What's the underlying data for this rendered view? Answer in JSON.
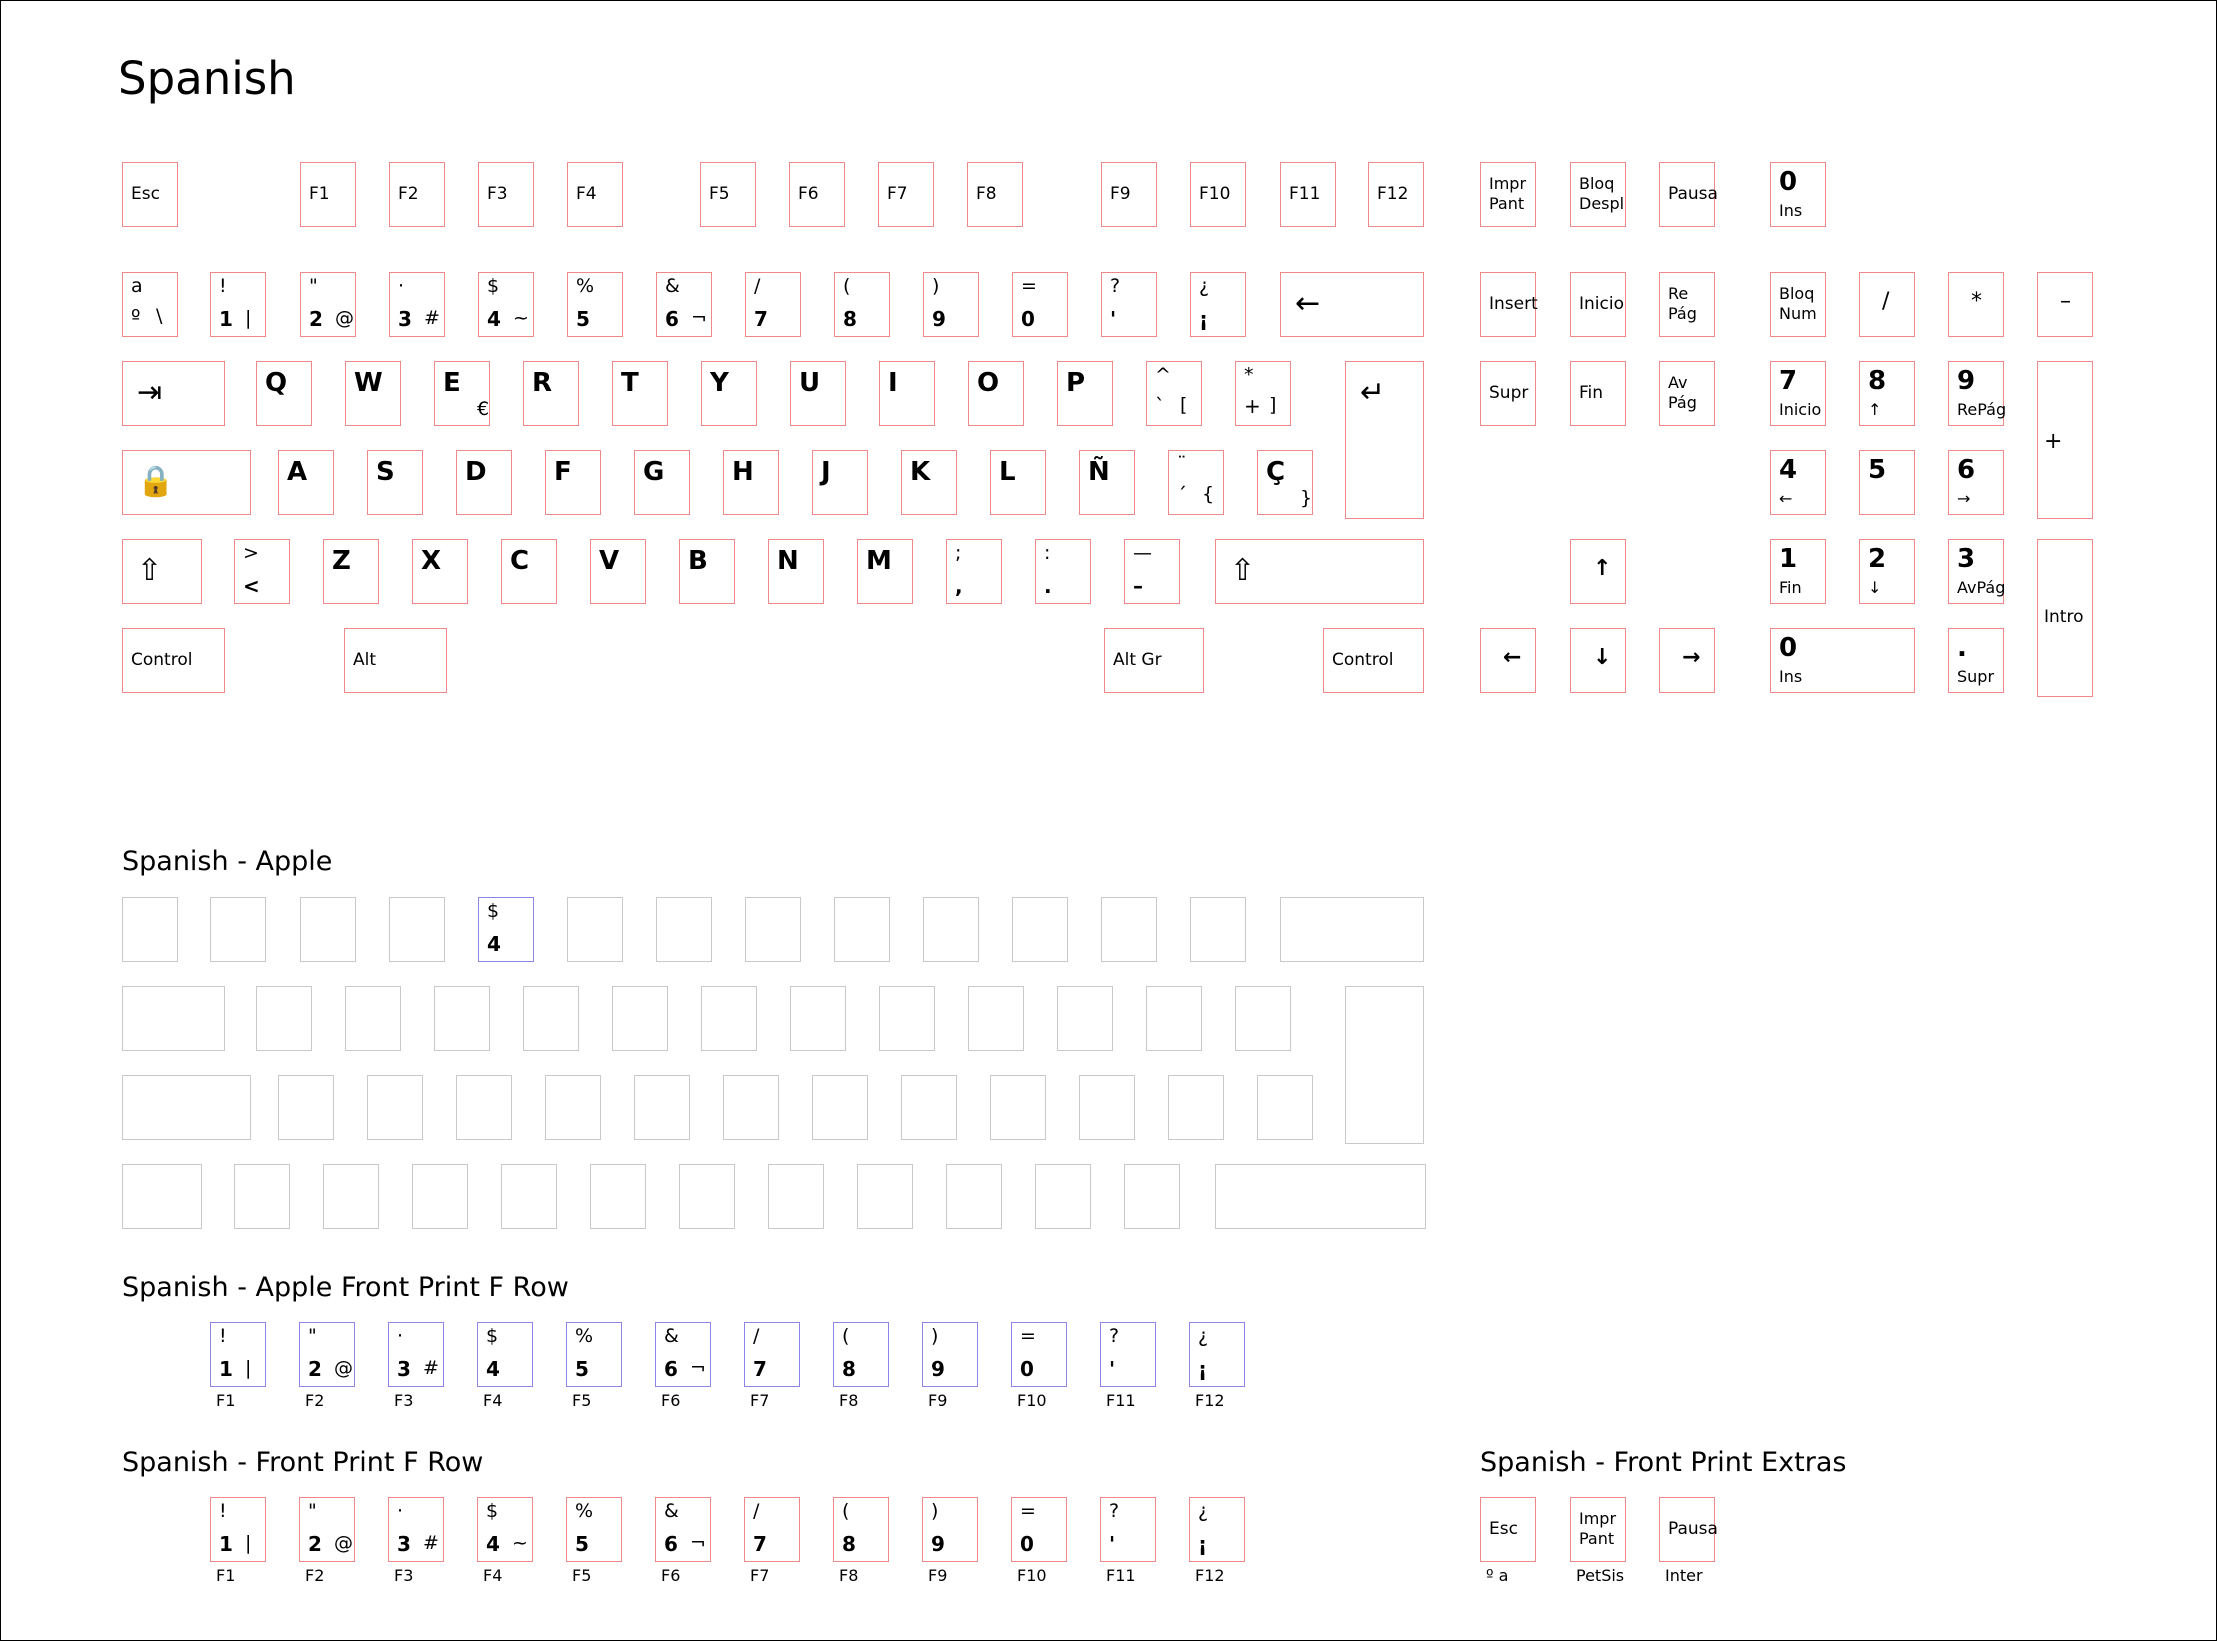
{
  "titles": {
    "main": "Spanish",
    "apple": "Spanish - Apple",
    "apple_front_f": "Spanish - Apple Front Print F Row",
    "front_f": "Spanish - Front Print F Row",
    "front_extras": "Spanish - Front Print Extras"
  },
  "colors": {
    "key_border": "#f08a8a",
    "blank_key_border": "#c9c9c9",
    "highlight_key_border": "#8c84e8"
  },
  "main": {
    "fn_row": [
      {
        "name": "key-esc",
        "labels": [
          "Esc"
        ]
      },
      {
        "name": "key-f1",
        "labels": [
          "F1"
        ]
      },
      {
        "name": "key-f2",
        "labels": [
          "F2"
        ]
      },
      {
        "name": "key-f3",
        "labels": [
          "F3"
        ]
      },
      {
        "name": "key-f4",
        "labels": [
          "F4"
        ]
      },
      {
        "name": "key-f5",
        "labels": [
          "F5"
        ]
      },
      {
        "name": "key-f6",
        "labels": [
          "F6"
        ]
      },
      {
        "name": "key-f7",
        "labels": [
          "F7"
        ]
      },
      {
        "name": "key-f8",
        "labels": [
          "F8"
        ]
      },
      {
        "name": "key-f9",
        "labels": [
          "F9"
        ]
      },
      {
        "name": "key-f10",
        "labels": [
          "F10"
        ]
      },
      {
        "name": "key-f11",
        "labels": [
          "F11"
        ]
      },
      {
        "name": "key-f12",
        "labels": [
          "F12"
        ]
      },
      {
        "name": "key-impr-pant",
        "labels": [
          "Impr",
          "Pant"
        ]
      },
      {
        "name": "key-bloq-despl",
        "labels": [
          "Bloq",
          "Despl"
        ]
      },
      {
        "name": "key-pausa",
        "labels": [
          "Pausa"
        ]
      },
      {
        "name": "key-extra-0-ins",
        "labels": [
          "0",
          "Ins"
        ]
      }
    ],
    "number_row": [
      {
        "name": "key-ordinal",
        "labels": [
          "a",
          "º",
          "\\"
        ]
      },
      {
        "name": "key-1",
        "labels": [
          "!",
          "1",
          "|"
        ]
      },
      {
        "name": "key-2",
        "labels": [
          "\"",
          "2",
          "@"
        ]
      },
      {
        "name": "key-3",
        "labels": [
          "·",
          "3",
          "#"
        ]
      },
      {
        "name": "key-4",
        "labels": [
          "$",
          "4",
          "~"
        ]
      },
      {
        "name": "key-5",
        "labels": [
          "%",
          "5"
        ]
      },
      {
        "name": "key-6",
        "labels": [
          "&",
          "6",
          "¬"
        ]
      },
      {
        "name": "key-7",
        "labels": [
          "/",
          "7"
        ]
      },
      {
        "name": "key-8",
        "labels": [
          "(",
          "8"
        ]
      },
      {
        "name": "key-9",
        "labels": [
          ")",
          "9"
        ]
      },
      {
        "name": "key-0",
        "labels": [
          "=",
          "0"
        ]
      },
      {
        "name": "key-apostrophe",
        "labels": [
          "?",
          "'"
        ]
      },
      {
        "name": "key-inverted-exclamation",
        "labels": [
          "¿",
          "¡"
        ]
      },
      {
        "name": "key-backspace",
        "labels": [
          "←"
        ]
      }
    ],
    "top_row": [
      {
        "name": "key-tab",
        "labels": [
          "⇥"
        ]
      },
      {
        "name": "key-q",
        "labels": [
          "Q"
        ]
      },
      {
        "name": "key-w",
        "labels": [
          "W"
        ]
      },
      {
        "name": "key-e",
        "labels": [
          "E",
          "€"
        ]
      },
      {
        "name": "key-r",
        "labels": [
          "R"
        ]
      },
      {
        "name": "key-t",
        "labels": [
          "T"
        ]
      },
      {
        "name": "key-y",
        "labels": [
          "Y"
        ]
      },
      {
        "name": "key-u",
        "labels": [
          "U"
        ]
      },
      {
        "name": "key-i",
        "labels": [
          "I"
        ]
      },
      {
        "name": "key-o",
        "labels": [
          "O"
        ]
      },
      {
        "name": "key-p",
        "labels": [
          "P"
        ]
      },
      {
        "name": "key-grave",
        "labels": [
          "^",
          "`",
          "["
        ]
      },
      {
        "name": "key-plus",
        "labels": [
          "*",
          "+",
          "]"
        ]
      },
      {
        "name": "key-enter",
        "labels": [
          "↵"
        ]
      }
    ],
    "home_row": [
      {
        "name": "key-caps-lock",
        "labels": [
          "🔒"
        ]
      },
      {
        "name": "key-a",
        "labels": [
          "A"
        ]
      },
      {
        "name": "key-s",
        "labels": [
          "S"
        ]
      },
      {
        "name": "key-d",
        "labels": [
          "D"
        ]
      },
      {
        "name": "key-f",
        "labels": [
          "F"
        ]
      },
      {
        "name": "key-g",
        "labels": [
          "G"
        ]
      },
      {
        "name": "key-h",
        "labels": [
          "H"
        ]
      },
      {
        "name": "key-j",
        "labels": [
          "J"
        ]
      },
      {
        "name": "key-k",
        "labels": [
          "K"
        ]
      },
      {
        "name": "key-l",
        "labels": [
          "L"
        ]
      },
      {
        "name": "key-n-tilde",
        "labels": [
          "Ñ"
        ]
      },
      {
        "name": "key-acute",
        "labels": [
          "¨",
          "´",
          "{"
        ]
      },
      {
        "name": "key-c-cedilla",
        "labels": [
          "Ç",
          "}"
        ]
      }
    ],
    "bottom_row": [
      {
        "name": "key-left-shift",
        "labels": [
          "⇧"
        ]
      },
      {
        "name": "key-less-than",
        "labels": [
          ">",
          "<"
        ]
      },
      {
        "name": "key-z",
        "labels": [
          "Z"
        ]
      },
      {
        "name": "key-x",
        "labels": [
          "X"
        ]
      },
      {
        "name": "key-c",
        "labels": [
          "C"
        ]
      },
      {
        "name": "key-v",
        "labels": [
          "V"
        ]
      },
      {
        "name": "key-b",
        "labels": [
          "B"
        ]
      },
      {
        "name": "key-n",
        "labels": [
          "N"
        ]
      },
      {
        "name": "key-m",
        "labels": [
          "M"
        ]
      },
      {
        "name": "key-comma",
        "labels": [
          ";",
          ","
        ]
      },
      {
        "name": "key-period",
        "labels": [
          ":",
          "."
        ]
      },
      {
        "name": "key-minus",
        "labels": [
          "—",
          "–"
        ]
      },
      {
        "name": "key-right-shift",
        "labels": [
          "⇧"
        ]
      }
    ],
    "space_row": [
      {
        "name": "key-left-control",
        "labels": [
          "Control"
        ]
      },
      {
        "name": "key-alt",
        "labels": [
          "Alt"
        ]
      },
      {
        "name": "key-alt-gr",
        "labels": [
          "Alt Gr"
        ]
      },
      {
        "name": "key-right-control",
        "labels": [
          "Control"
        ]
      }
    ],
    "nav": [
      {
        "name": "key-insert",
        "labels": [
          "Insert"
        ]
      },
      {
        "name": "key-inicio",
        "labels": [
          "Inicio"
        ]
      },
      {
        "name": "key-re-pag",
        "labels": [
          "Re",
          "Pág"
        ]
      },
      {
        "name": "key-supr",
        "labels": [
          "Supr"
        ]
      },
      {
        "name": "key-fin",
        "labels": [
          "Fin"
        ]
      },
      {
        "name": "key-av-pag",
        "labels": [
          "Av",
          "Pág"
        ]
      },
      {
        "name": "key-arrow-up",
        "labels": [
          "↑"
        ]
      },
      {
        "name": "key-arrow-left",
        "labels": [
          "←"
        ]
      },
      {
        "name": "key-arrow-down",
        "labels": [
          "↓"
        ]
      },
      {
        "name": "key-arrow-right",
        "labels": [
          "→"
        ]
      }
    ],
    "numpad": [
      {
        "name": "key-bloq-num",
        "labels": [
          "Bloq",
          "Num"
        ]
      },
      {
        "name": "key-num-divide",
        "labels": [
          "/"
        ]
      },
      {
        "name": "key-num-multiply",
        "labels": [
          "*"
        ]
      },
      {
        "name": "key-num-minus",
        "labels": [
          "–"
        ]
      },
      {
        "name": "key-num-7",
        "labels": [
          "7",
          "Inicio"
        ]
      },
      {
        "name": "key-num-8",
        "labels": [
          "8",
          "↑"
        ]
      },
      {
        "name": "key-num-9",
        "labels": [
          "9",
          "RePág"
        ]
      },
      {
        "name": "key-num-plus",
        "labels": [
          "+"
        ]
      },
      {
        "name": "key-num-4",
        "labels": [
          "4",
          "←"
        ]
      },
      {
        "name": "key-num-5",
        "labels": [
          "5"
        ]
      },
      {
        "name": "key-num-6",
        "labels": [
          "6",
          "→"
        ]
      },
      {
        "name": "key-num-1",
        "labels": [
          "1",
          "Fin"
        ]
      },
      {
        "name": "key-num-2",
        "labels": [
          "2",
          "↓"
        ]
      },
      {
        "name": "key-num-3",
        "labels": [
          "3",
          "AvPág"
        ]
      },
      {
        "name": "key-num-intro",
        "labels": [
          "Intro"
        ]
      },
      {
        "name": "key-num-0",
        "labels": [
          "0",
          "Ins"
        ]
      },
      {
        "name": "key-num-decimal",
        "labels": [
          ".",
          "Supr"
        ]
      }
    ]
  },
  "apple": {
    "highlight": {
      "name": "apple-key-4",
      "labels": [
        "$",
        "4"
      ]
    }
  },
  "apple_front_row": [
    {
      "labels": [
        "!",
        "1",
        "|"
      ],
      "front": "F1"
    },
    {
      "labels": [
        "\"",
        "2",
        "@"
      ],
      "front": "F2"
    },
    {
      "labels": [
        "·",
        "3",
        "#"
      ],
      "front": "F3"
    },
    {
      "labels": [
        "$",
        "4"
      ],
      "front": "F4"
    },
    {
      "labels": [
        "%",
        "5"
      ],
      "front": "F5"
    },
    {
      "labels": [
        "&",
        "6",
        "¬"
      ],
      "front": "F6"
    },
    {
      "labels": [
        "/",
        "7"
      ],
      "front": "F7"
    },
    {
      "labels": [
        "(",
        "8"
      ],
      "front": "F8"
    },
    {
      "labels": [
        ")",
        "9"
      ],
      "front": "F9"
    },
    {
      "labels": [
        "=",
        "0"
      ],
      "front": "F10"
    },
    {
      "labels": [
        "?",
        "'"
      ],
      "front": "F11"
    },
    {
      "labels": [
        "¿",
        "¡"
      ],
      "front": "F12"
    }
  ],
  "front_row": [
    {
      "labels": [
        "!",
        "1",
        "|"
      ],
      "front": "F1"
    },
    {
      "labels": [
        "\"",
        "2",
        "@"
      ],
      "front": "F2"
    },
    {
      "labels": [
        "·",
        "3",
        "#"
      ],
      "front": "F3"
    },
    {
      "labels": [
        "$",
        "4",
        "~"
      ],
      "front": "F4"
    },
    {
      "labels": [
        "%",
        "5"
      ],
      "front": "F5"
    },
    {
      "labels": [
        "&",
        "6",
        "¬"
      ],
      "front": "F6"
    },
    {
      "labels": [
        "/",
        "7"
      ],
      "front": "F7"
    },
    {
      "labels": [
        "(",
        "8"
      ],
      "front": "F8"
    },
    {
      "labels": [
        ")",
        "9"
      ],
      "front": "F9"
    },
    {
      "labels": [
        "=",
        "0"
      ],
      "front": "F10"
    },
    {
      "labels": [
        "?",
        "'"
      ],
      "front": "F11"
    },
    {
      "labels": [
        "¿",
        "¡"
      ],
      "front": "F12"
    }
  ],
  "front_extras": [
    {
      "name": "extras-esc",
      "labels": [
        "Esc"
      ],
      "front": "º  a"
    },
    {
      "name": "extras-impr-pant",
      "labels": [
        "Impr",
        "Pant"
      ],
      "front": "PetSis"
    },
    {
      "name": "extras-pausa",
      "labels": [
        "Pausa"
      ],
      "front": "Inter"
    }
  ]
}
